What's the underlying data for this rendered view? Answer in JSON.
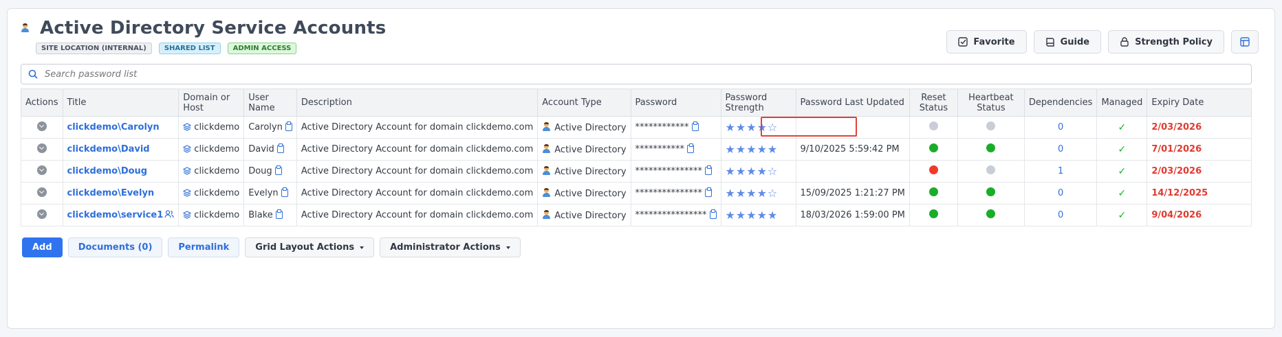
{
  "header": {
    "title": "Active Directory Service Accounts",
    "badges": [
      "SITE LOCATION (INTERNAL)",
      "SHARED LIST",
      "ADMIN ACCESS"
    ]
  },
  "top_buttons": {
    "favorite": "Favorite",
    "guide": "Guide",
    "strength_policy": "Strength Policy"
  },
  "search": {
    "placeholder": "Search password list"
  },
  "table": {
    "headers": {
      "actions": "Actions",
      "title": "Title",
      "domain": "Domain or Host",
      "username": "User Name",
      "description": "Description",
      "account_type": "Account Type",
      "password": "Password",
      "strength": "Password Strength",
      "last_updated": "Password Last Updated",
      "reset_status_1": "Reset",
      "reset_status_2": "Status",
      "heartbeat_status_1": "Heartbeat",
      "heartbeat_status_2": "Status",
      "dependencies": "Dependencies",
      "managed": "Managed",
      "expiry": "Expiry Date"
    },
    "rows": [
      {
        "title": "clickdemo\\Carolyn",
        "domain": "clickdemo",
        "username": "Carolyn",
        "description": "Active Directory Account for domain clickdemo.com",
        "account_type": "Active Directory",
        "password": "************",
        "strength": "★★★★☆",
        "last_updated": "",
        "reset": "gray",
        "heartbeat": "gray",
        "dependencies": "0",
        "managed": "✓",
        "expiry": "2/03/2026"
      },
      {
        "title": "clickdemo\\David",
        "domain": "clickdemo",
        "username": "David",
        "description": "Active Directory Account for domain clickdemo.com",
        "account_type": "Active Directory",
        "password": "***********",
        "strength": "★★★★★",
        "last_updated": "9/10/2025 5:59:42 PM",
        "reset": "green",
        "heartbeat": "green",
        "dependencies": "0",
        "managed": "✓",
        "expiry": "7/01/2026"
      },
      {
        "title": "clickdemo\\Doug",
        "domain": "clickdemo",
        "username": "Doug",
        "description": "Active Directory Account for domain clickdemo.com",
        "account_type": "Active Directory",
        "password": "***************",
        "strength": "★★★★☆",
        "last_updated": "",
        "reset": "red",
        "heartbeat": "gray",
        "dependencies": "1",
        "managed": "✓",
        "expiry": "2/03/2026"
      },
      {
        "title": "clickdemo\\Evelyn",
        "domain": "clickdemo",
        "username": "Evelyn",
        "description": "Active Directory Account for domain clickdemo.com",
        "account_type": "Active Directory",
        "password": "***************",
        "strength": "★★★★☆",
        "last_updated": "15/09/2025 1:21:27 PM",
        "reset": "green",
        "heartbeat": "green",
        "dependencies": "0",
        "managed": "✓",
        "expiry": "14/12/2025"
      },
      {
        "title": "clickdemo\\service1",
        "domain": "clickdemo",
        "username": "Blake",
        "description": "Active Directory Account for domain clickdemo.com",
        "account_type": "Active Directory",
        "password": "****************",
        "strength": "★★★★★",
        "last_updated": "18/03/2026 1:59:00 PM",
        "reset": "green",
        "heartbeat": "green",
        "dependencies": "0",
        "managed": "✓",
        "expiry": "9/04/2026"
      }
    ]
  },
  "bottom_buttons": {
    "add": "Add",
    "documents": "Documents (0)",
    "permalink": "Permalink",
    "grid_layout": "Grid Layout Actions",
    "admin_actions": "Administrator Actions"
  },
  "colors": {
    "accent": "#2e6fd9",
    "primary_button": "#2f73ef",
    "status_green": "#1aad2a",
    "status_red": "#ef3a2a",
    "status_gray": "#c9cdd7",
    "expiry_red": "#e03a2f",
    "highlight": "#e0413a"
  }
}
